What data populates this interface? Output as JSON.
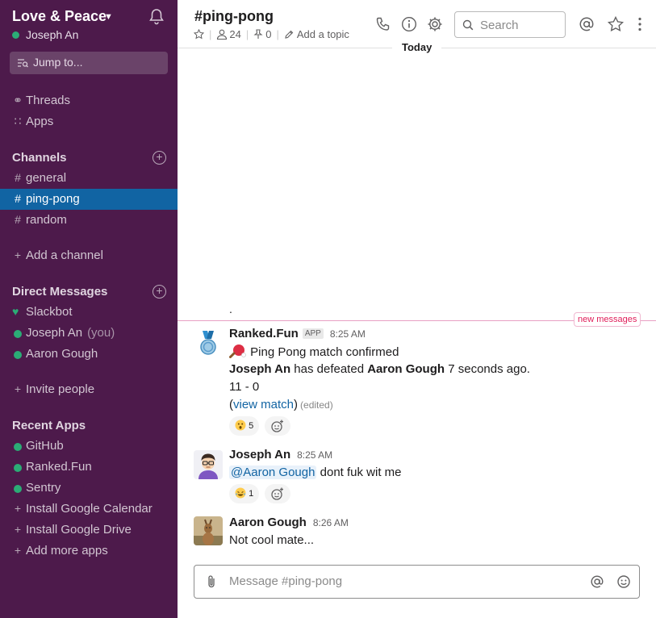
{
  "workspace": {
    "name": "Love & Peace",
    "user": "Joseph An"
  },
  "sidebar": {
    "jump_label": "Jump to...",
    "top_items": [
      {
        "label": "Threads",
        "icon": "threads-icon"
      },
      {
        "label": "Apps",
        "icon": "apps-grid-icon"
      }
    ],
    "channels_title": "Channels",
    "channels": [
      "general",
      "ping-pong",
      "random"
    ],
    "active_channel": "ping-pong",
    "add_channel": "Add a channel",
    "dm_title": "Direct Messages",
    "dms": [
      {
        "label": "Slackbot"
      },
      {
        "label": "Joseph An",
        "suffix": "(you)"
      },
      {
        "label": "Aaron Gough"
      }
    ],
    "invite": "Invite people",
    "apps_title": "Recent Apps",
    "apps": [
      "GitHub",
      "Ranked.Fun",
      "Sentry"
    ],
    "install_items": [
      "Install Google Calendar",
      "Install Google Drive",
      "Add more apps"
    ]
  },
  "header": {
    "channel_title": "#ping-pong",
    "members": "24",
    "pins": "0",
    "topic": "Add a topic",
    "search_placeholder": "Search"
  },
  "divider": {
    "today": "Today",
    "new_messages": "new messages"
  },
  "messages": [
    {
      "author": "Ranked.Fun",
      "badge": "APP",
      "time": "8:25 AM",
      "line1": "Ping Pong match confirmed",
      "line2_winner": "Joseph An",
      "line2_mid": "has defeated",
      "line2_loser": "Aaron Gough",
      "line2_end": "7 seconds ago.",
      "score": "11 - 0",
      "link_open": "(",
      "link": "view match",
      "link_close": ")",
      "edited": "(edited)",
      "reaction_count": "5"
    },
    {
      "author": "Joseph An",
      "time": "8:25 AM",
      "mention": "@Aaron Gough",
      "text": "dont fuk wit me",
      "reaction_count": "1"
    },
    {
      "author": "Aaron Gough",
      "time": "8:26 AM",
      "text": "Not cool mate..."
    }
  ],
  "previous_message_text": ".",
  "composer": {
    "placeholder": "Message #ping-pong"
  },
  "colors": {
    "sidebar": "#4d1a4b",
    "active": "#1164a3",
    "presence": "#2bac76",
    "link": "#1264a3",
    "new_messages": "#e01e5a"
  }
}
